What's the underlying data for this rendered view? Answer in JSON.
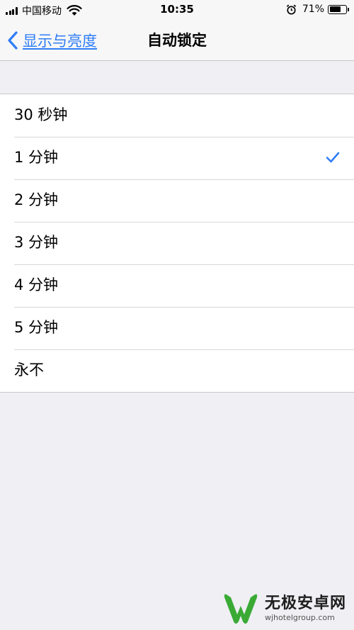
{
  "status_bar": {
    "carrier": "中国移动",
    "time": "10:35",
    "battery_percent": "71%",
    "battery_level": 0.71,
    "icons": [
      "signal-icon",
      "wifi-icon",
      "alarm-icon",
      "battery-icon"
    ]
  },
  "nav": {
    "back_label": "显示与亮度",
    "title": "自动锁定"
  },
  "options": [
    {
      "label": "30 秒钟",
      "selected": false
    },
    {
      "label": "1 分钟",
      "selected": true
    },
    {
      "label": "2 分钟",
      "selected": false
    },
    {
      "label": "3 分钟",
      "selected": false
    },
    {
      "label": "4 分钟",
      "selected": false
    },
    {
      "label": "5 分钟",
      "selected": false
    },
    {
      "label": "永不",
      "selected": false
    }
  ],
  "watermark": {
    "title": "无极安卓网",
    "subtitle": "wjhotelgroup.com"
  },
  "colors": {
    "accent": "#2f7df6",
    "background": "#efeff4",
    "watermark_green": "#3aaa35"
  }
}
